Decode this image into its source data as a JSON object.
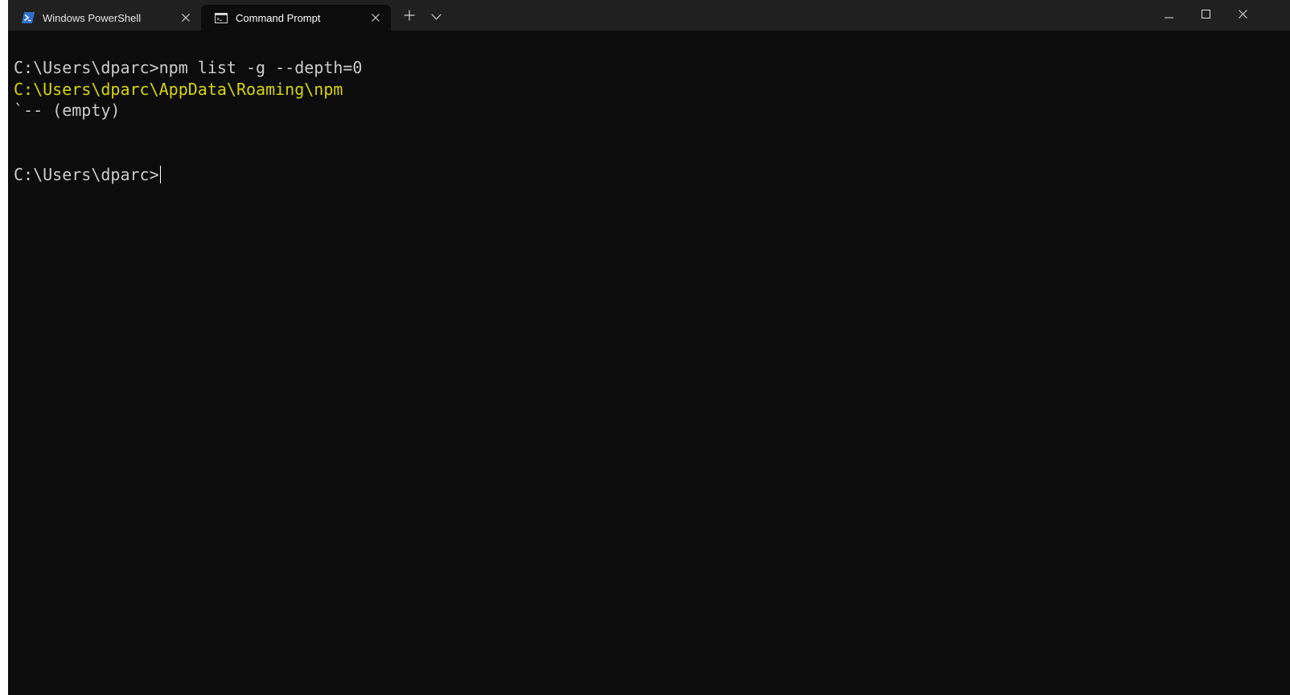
{
  "tabs": [
    {
      "label": "Windows PowerShell",
      "icon": "powershell-icon",
      "active": false
    },
    {
      "label": "Command Prompt",
      "icon": "cmd-icon",
      "active": true
    }
  ],
  "icons": {
    "close": "close-icon",
    "new_tab": "plus-icon",
    "dropdown": "chevron-down-icon",
    "minimize": "minimize-icon",
    "maximize": "maximize-icon",
    "window_close": "close-icon"
  },
  "terminal": {
    "lines": [
      "C:\\Users\\dparc>npm list -g --depth=0",
      "C:\\Users\\dparc\\AppData\\Roaming\\npm",
      "`-- (empty)",
      "",
      "",
      "C:\\Users\\dparc>"
    ]
  },
  "colors": {
    "background": "#0c0c0c",
    "titlebar": "#202020",
    "text": "#cccccc",
    "highlight": "#d7d500",
    "powershell_blue": "#2f6fce"
  }
}
